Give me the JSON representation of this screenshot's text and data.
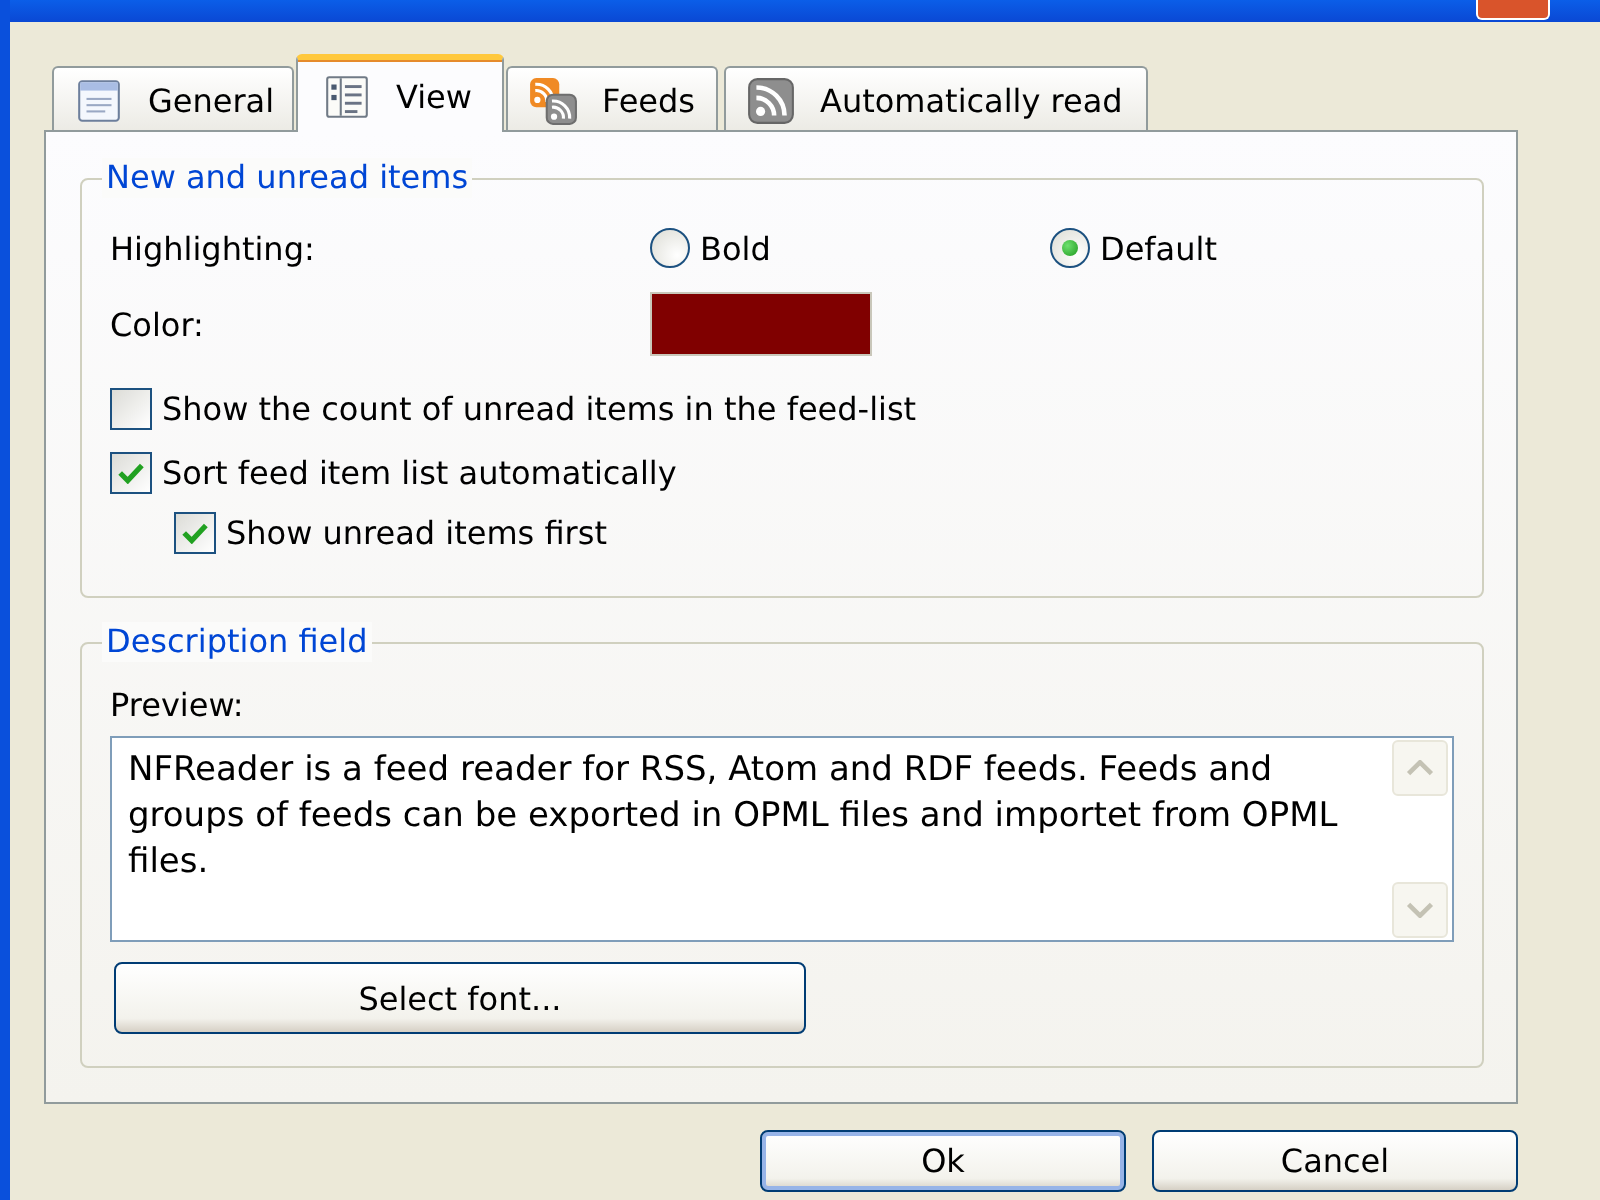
{
  "tabs": [
    {
      "label": "General",
      "selected": false
    },
    {
      "label": "View",
      "selected": true
    },
    {
      "label": "Feeds",
      "selected": false
    },
    {
      "label": "Automatically read",
      "selected": false
    }
  ],
  "new_items_group": {
    "title": "New and unread items",
    "highlighting": {
      "label": "Highlighting:",
      "options": [
        {
          "label": "Bold",
          "selected": false
        },
        {
          "label": "Default",
          "selected": true
        }
      ]
    },
    "color": {
      "label": "Color:",
      "color": "#800000"
    },
    "checkboxes": [
      {
        "label": "Show the count of unread items in the feed-list",
        "checked": false
      },
      {
        "label": "Sort feed item list automatically",
        "checked": true,
        "children": [
          {
            "label": "Show unread items first",
            "checked": true
          }
        ]
      }
    ]
  },
  "description_group": {
    "title": "Description field",
    "preview": {
      "label": "Preview:",
      "value": "NFReader is a feed reader for RSS, Atom and RDF feeds. Feeds and groups of feeds can be exported in OPML files and importet from OPML files."
    },
    "font_button": "Select font..."
  },
  "buttons": [
    {
      "label": "Ok",
      "default": true
    },
    {
      "label": "Cancel",
      "default": false
    }
  ]
}
